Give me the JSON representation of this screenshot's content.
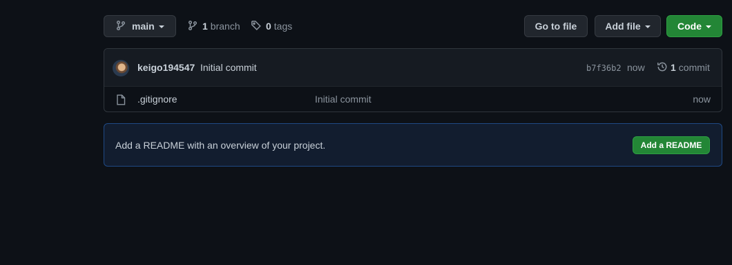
{
  "toolbar": {
    "branch_selector": "main",
    "branch_count": "1",
    "branch_label": "branch",
    "tag_count": "0",
    "tag_label": "tags",
    "goto_file": "Go to file",
    "add_file": "Add file",
    "code": "Code"
  },
  "latest_commit": {
    "author": "keigo194547",
    "message": "Initial commit",
    "sha": "b7f36b2",
    "time": "now",
    "commit_count": "1",
    "commit_label": "commit"
  },
  "files": [
    {
      "name": ".gitignore",
      "commit_message": "Initial commit",
      "time": "now",
      "icon": "file-icon"
    }
  ],
  "readme_banner": {
    "text": "Add a README with an overview of your project.",
    "button": "Add a README"
  },
  "colors": {
    "background": "#0d1117",
    "primary_button": "#238636",
    "banner_border": "#1f4a85"
  }
}
